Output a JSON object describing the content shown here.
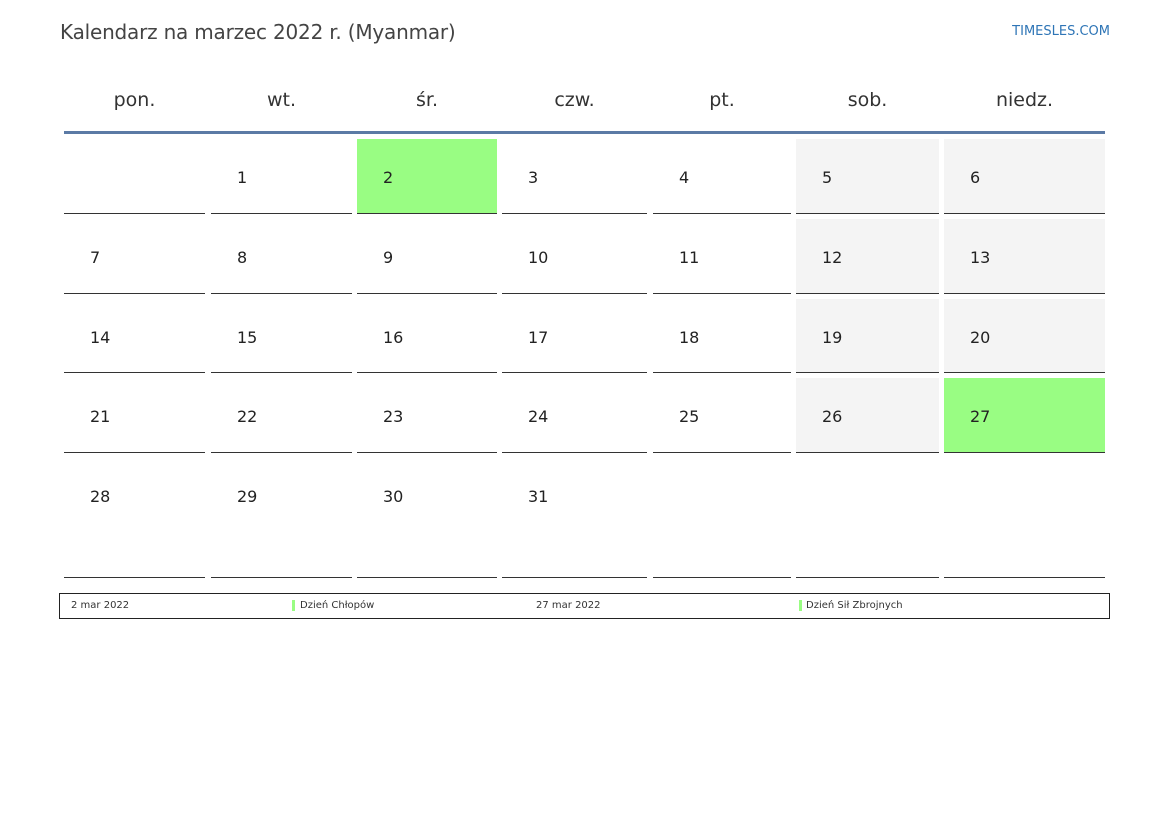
{
  "header": {
    "title": "Kalendarz na marzec 2022 r. (Myanmar)",
    "brand": "TIMESLES.COM"
  },
  "weekdays": [
    "pon.",
    "wt.",
    "śr.",
    "czw.",
    "pt.",
    "sob.",
    "niedz."
  ],
  "weeks": [
    [
      null,
      1,
      2,
      3,
      4,
      5,
      6
    ],
    [
      7,
      8,
      9,
      10,
      11,
      12,
      13
    ],
    [
      14,
      15,
      16,
      17,
      18,
      19,
      20
    ],
    [
      21,
      22,
      23,
      24,
      25,
      26,
      27
    ],
    [
      28,
      29,
      30,
      31,
      null,
      null,
      null
    ]
  ],
  "holidays": [
    2,
    27
  ],
  "legend": [
    {
      "date": "2 mar 2022",
      "name": "Dzień Chłopów"
    },
    {
      "date": "27 mar 2022",
      "name": "Dzień Sił Zbrojnych"
    }
  ],
  "colors": {
    "holiday": "#99fd83",
    "weekend": "#f4f4f4",
    "header_rule": "#5b7aa5",
    "brand": "#2e75b6"
  }
}
